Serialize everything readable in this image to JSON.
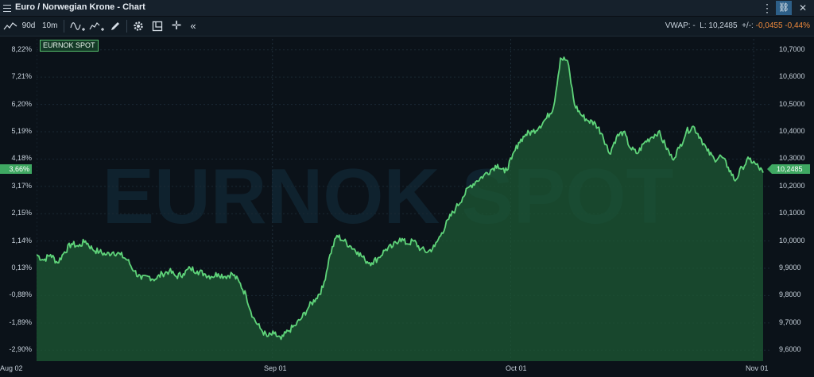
{
  "window": {
    "title": "Euro / Norwegian Krone - Chart",
    "menu_icon": "hamburger-menu-icon",
    "kebab_icon": "more-vertical-icon",
    "pin_icon": "pin-link-icon",
    "close_icon": "close-icon"
  },
  "toolbar": {
    "period_label": "90d",
    "interval_label": "10m",
    "stats_vwap": "VWAP: -",
    "stats_last": "L: 10,2485",
    "stats_change_label": "+/-:",
    "stats_change": "-0,0455",
    "stats_change_pct": "-0,44%",
    "change_color": "#f08a3c"
  },
  "chart_data": {
    "type": "area",
    "series_name": "EURNOK SPOT",
    "watermark": "EURNOK SPOT",
    "x_labels": [
      "Aug 02",
      "Sep 01",
      "Oct 01",
      "Nov 01"
    ],
    "left_axis_ticks": [
      "8,22%",
      "7,21%",
      "6,20%",
      "5,19%",
      "4,18%",
      "3,17%",
      "2,15%",
      "1,14%",
      "0,13%",
      "-0,88%",
      "-1,89%",
      "-2,90%"
    ],
    "right_axis_ticks": [
      "10,7000",
      "10,6000",
      "10,5000",
      "10,4000",
      "10,3000",
      "10,2000",
      "10,1000",
      "10,0000",
      "9,9000",
      "9,8000",
      "9,7000",
      "9,6000"
    ],
    "current_pct_label": "3,66%",
    "current_price_label": "10,2485",
    "ylim": [
      9.56,
      10.74
    ],
    "xlim": [
      0,
      92
    ],
    "line_color": "#5fd47a",
    "fill_color": "#1d5a34",
    "points": [
      [
        0,
        9.95
      ],
      [
        1,
        9.93
      ],
      [
        2,
        9.95
      ],
      [
        3,
        9.92
      ],
      [
        4,
        9.96
      ],
      [
        5,
        9.99
      ],
      [
        6,
        9.98
      ],
      [
        7,
        10.0
      ],
      [
        8,
        9.97
      ],
      [
        9,
        9.96
      ],
      [
        10,
        9.95
      ],
      [
        11,
        9.96
      ],
      [
        12,
        9.95
      ],
      [
        13,
        9.93
      ],
      [
        14,
        9.89
      ],
      [
        15,
        9.86
      ],
      [
        16,
        9.87
      ],
      [
        17,
        9.86
      ],
      [
        18,
        9.88
      ],
      [
        19,
        9.89
      ],
      [
        20,
        9.87
      ],
      [
        21,
        9.88
      ],
      [
        22,
        9.9
      ],
      [
        23,
        9.89
      ],
      [
        24,
        9.88
      ],
      [
        25,
        9.87
      ],
      [
        26,
        9.88
      ],
      [
        27,
        9.87
      ],
      [
        28,
        9.88
      ],
      [
        29,
        9.85
      ],
      [
        30,
        9.8
      ],
      [
        31,
        9.72
      ],
      [
        32,
        9.68
      ],
      [
        33,
        9.65
      ],
      [
        34,
        9.66
      ],
      [
        35,
        9.64
      ],
      [
        36,
        9.67
      ],
      [
        37,
        9.69
      ],
      [
        38,
        9.72
      ],
      [
        39,
        9.76
      ],
      [
        40,
        9.79
      ],
      [
        41,
        9.83
      ],
      [
        42,
        9.95
      ],
      [
        43,
        10.02
      ],
      [
        44,
        10.0
      ],
      [
        45,
        9.98
      ],
      [
        46,
        9.96
      ],
      [
        47,
        9.93
      ],
      [
        48,
        9.92
      ],
      [
        49,
        9.94
      ],
      [
        50,
        9.97
      ],
      [
        51,
        9.98
      ],
      [
        52,
        10.01
      ],
      [
        53,
        9.99
      ],
      [
        54,
        10.0
      ],
      [
        55,
        9.97
      ],
      [
        56,
        9.96
      ],
      [
        57,
        9.98
      ],
      [
        58,
        10.03
      ],
      [
        59,
        10.08
      ],
      [
        60,
        10.12
      ],
      [
        61,
        10.16
      ],
      [
        62,
        10.2
      ],
      [
        63,
        10.22
      ],
      [
        64,
        10.24
      ],
      [
        65,
        10.26
      ],
      [
        66,
        10.28
      ],
      [
        67,
        10.25
      ],
      [
        68,
        10.3
      ],
      [
        69,
        10.36
      ],
      [
        70,
        10.39
      ],
      [
        71,
        10.4
      ],
      [
        72,
        10.42
      ],
      [
        73,
        10.45
      ],
      [
        74,
        10.49
      ],
      [
        75,
        10.67
      ],
      [
        76,
        10.66
      ],
      [
        77,
        10.5
      ],
      [
        78,
        10.46
      ],
      [
        79,
        10.44
      ],
      [
        80,
        10.43
      ],
      [
        81,
        10.39
      ],
      [
        82,
        10.32
      ],
      [
        83,
        10.38
      ],
      [
        84,
        10.4
      ],
      [
        85,
        10.34
      ],
      [
        86,
        10.32
      ],
      [
        87,
        10.36
      ],
      [
        88,
        10.38
      ],
      [
        89,
        10.4
      ],
      [
        90,
        10.35
      ],
      [
        91,
        10.3
      ],
      [
        92,
        10.34
      ],
      [
        93,
        10.4
      ],
      [
        94,
        10.42
      ],
      [
        95,
        10.38
      ],
      [
        96,
        10.33
      ],
      [
        97,
        10.3
      ],
      [
        98,
        10.31
      ],
      [
        99,
        10.27
      ],
      [
        100,
        10.22
      ],
      [
        101,
        10.27
      ],
      [
        102,
        10.3
      ],
      [
        103,
        10.28
      ],
      [
        104,
        10.25
      ]
    ]
  }
}
